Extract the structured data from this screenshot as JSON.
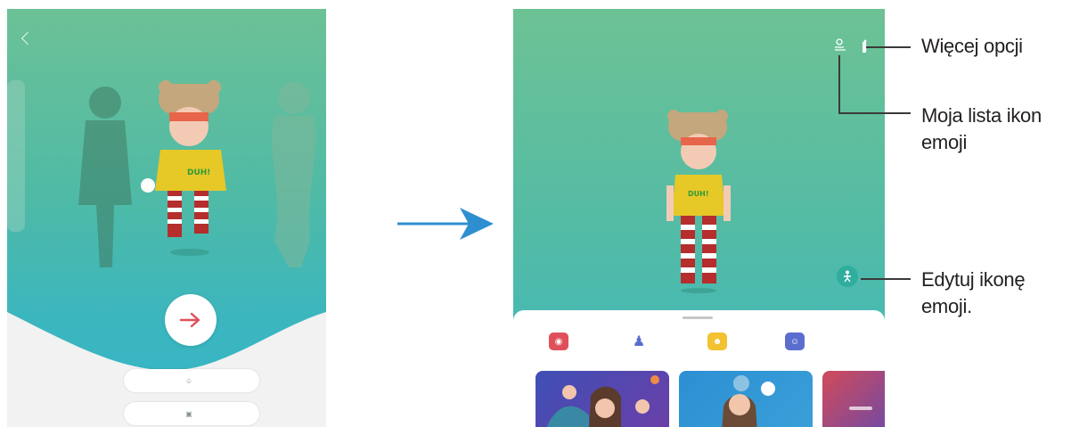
{
  "colors": {
    "flow_arrow": "#2e8fd0",
    "next_arrow": "#e0505a",
    "sheet": "#ffffff",
    "edit_button": "#2fae9e"
  },
  "left_screen": {
    "back_icon": "chevron-left-icon",
    "next_icon": "arrow-right-icon",
    "subtitle": "",
    "create_with_camera_label": "",
    "create_from_image_label": ""
  },
  "right_screen": {
    "title": "",
    "top_icons": [
      "person-list-icon",
      "more-options-icon"
    ],
    "edit_button_icon": "person-walk-icon",
    "categories": [
      {
        "icon": "camera-icon",
        "label": "",
        "color": "#e0505a"
      },
      {
        "icon": "figure-icon",
        "label": "",
        "color": "#5b6ecf"
      },
      {
        "icon": "sticker-icon",
        "label": "",
        "color": "#f2c230"
      },
      {
        "icon": "profile-icon",
        "label": "",
        "color": "#5b6ecf"
      }
    ]
  },
  "callouts": {
    "more_options": "Więcej opcji",
    "my_list_line1": "Moja lista ikon",
    "my_list_line2": "emoji",
    "edit_line1": "Edytuj ikonę",
    "edit_line2": "emoji."
  }
}
